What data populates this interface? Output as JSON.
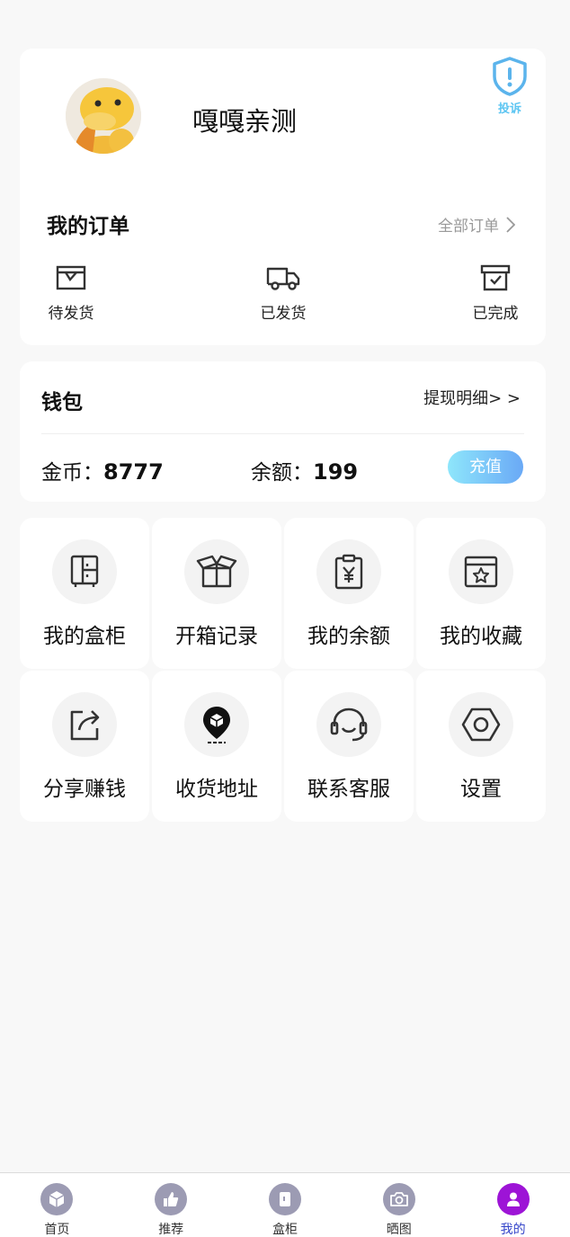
{
  "profile": {
    "username": "嘎嘎亲测",
    "complaint_label": "投诉"
  },
  "orders": {
    "title": "我的订单",
    "all_orders": "全部订单",
    "items": [
      {
        "label": "待发货",
        "icon": "package-box-icon"
      },
      {
        "label": "已发货",
        "icon": "truck-icon"
      },
      {
        "label": "已完成",
        "icon": "archive-check-icon"
      }
    ]
  },
  "wallet": {
    "title": "钱包",
    "withdraw_link": "提现明细> >",
    "coins_label": "金币：",
    "coins_value": "8777",
    "balance_label": "余额：",
    "balance_value": "199",
    "recharge_label": "充值"
  },
  "grid": [
    {
      "label": "我的盒柜",
      "icon": "cabinet-icon"
    },
    {
      "label": "开箱记录",
      "icon": "open-box-icon"
    },
    {
      "label": "我的余额",
      "icon": "yen-clipboard-icon"
    },
    {
      "label": "我的收藏",
      "icon": "star-box-icon"
    },
    {
      "label": "分享赚钱",
      "icon": "share-icon"
    },
    {
      "label": "收货地址",
      "icon": "location-pin-icon"
    },
    {
      "label": "联系客服",
      "icon": "headset-icon"
    },
    {
      "label": "设置",
      "icon": "hexagon-settings-icon"
    }
  ],
  "tabbar": [
    {
      "label": "首页",
      "icon": "cube-icon",
      "active": false
    },
    {
      "label": "推荐",
      "icon": "thumbs-up-icon",
      "active": false
    },
    {
      "label": "盒柜",
      "icon": "cabinet-icon",
      "active": false
    },
    {
      "label": "晒图",
      "icon": "camera-icon",
      "active": false
    },
    {
      "label": "我的",
      "icon": "user-icon",
      "active": true
    }
  ],
  "colors": {
    "accent_active_tab": "#9d14d6",
    "active_tab_text": "#3344c9",
    "inactive_tab": "#9c9bb3",
    "recharge_gradient_start": "#8ee6fb",
    "recharge_gradient_end": "#6aa9f6",
    "complaint": "#5bc5f2"
  }
}
